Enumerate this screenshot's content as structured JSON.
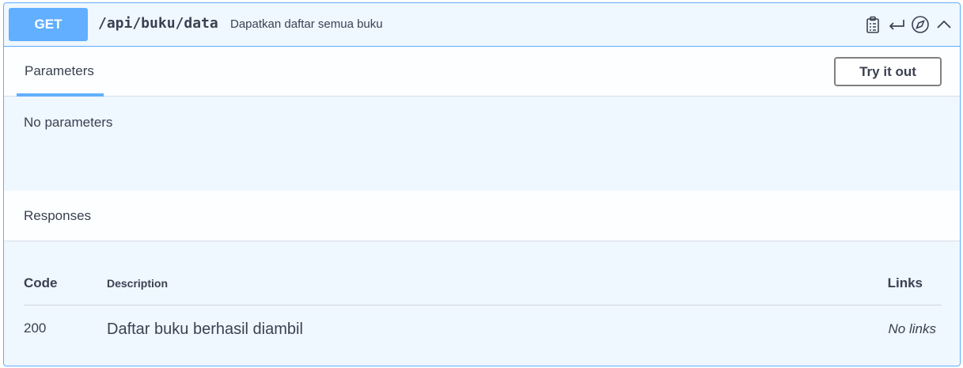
{
  "operation": {
    "method": "GET",
    "path": "/api/buku/data",
    "summary": "Dapatkan daftar semua buku",
    "icons": [
      "clipboard-icon",
      "return-icon",
      "compass-icon",
      "chevron-up-icon"
    ],
    "accent_color": "#61affe"
  },
  "parameters": {
    "tab_label": "Parameters",
    "try_button": "Try it out",
    "empty_text": "No parameters"
  },
  "responses": {
    "title": "Responses",
    "headers": {
      "code": "Code",
      "description": "Description",
      "links": "Links"
    },
    "rows": [
      {
        "code": "200",
        "description": "Daftar buku berhasil diambil",
        "links": "No links"
      }
    ]
  }
}
